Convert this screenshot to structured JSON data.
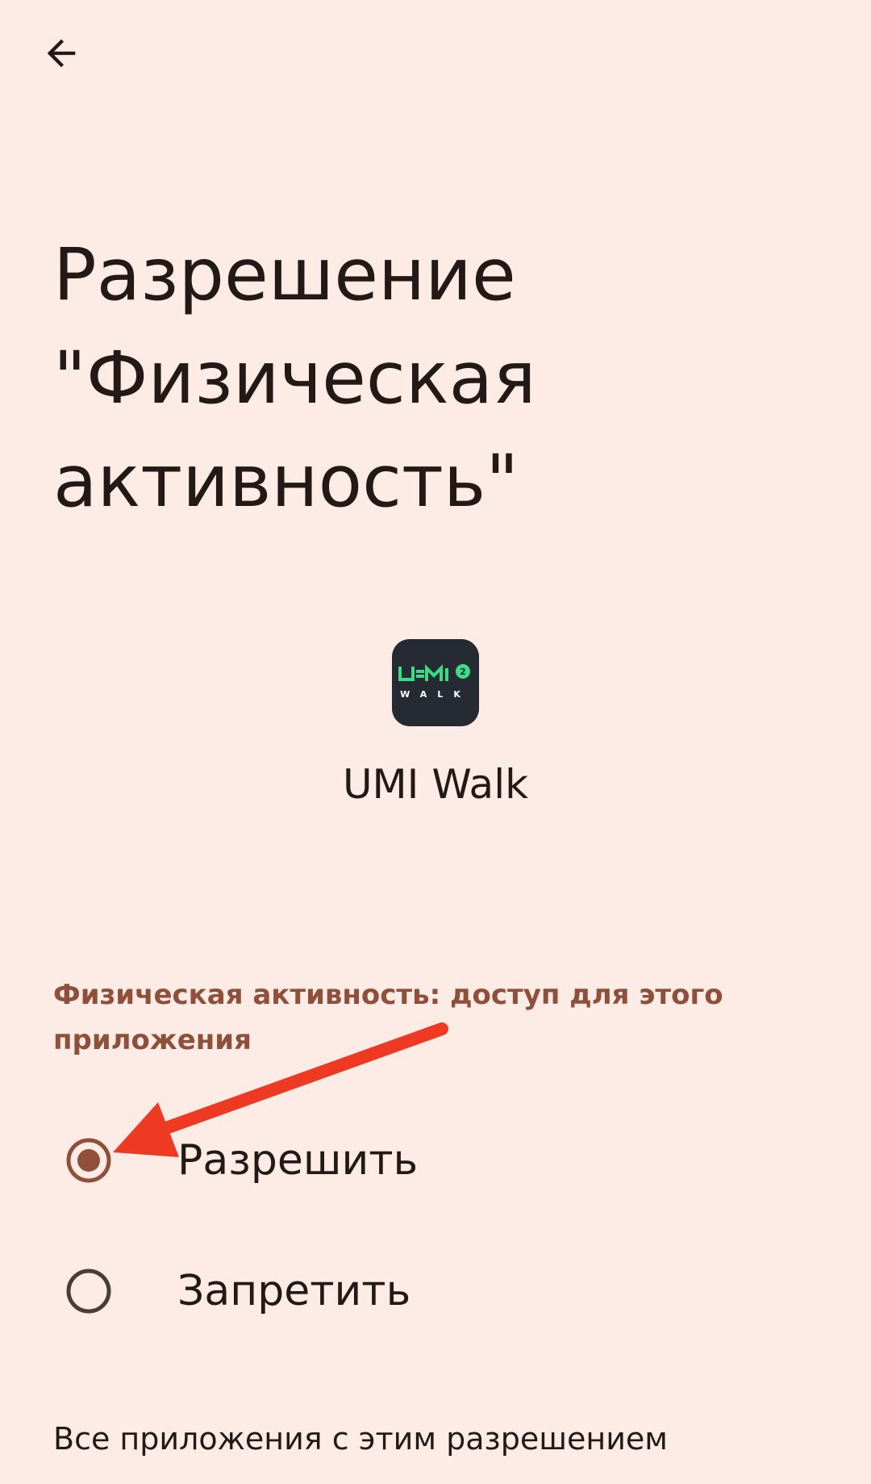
{
  "header": {
    "back_icon": "arrow-back-icon",
    "title": "Разрешение \"Физическая активность\""
  },
  "app": {
    "icon": "umi-walk-app-icon",
    "name": "UMI Walk",
    "icon_bg_color": "#262a33",
    "icon_accent_color": "#3ddc84"
  },
  "permission": {
    "section_title": "Физическая активность: доступ для этого приложения",
    "options": [
      {
        "label": "Разрешить",
        "selected": true
      },
      {
        "label": "Запретить",
        "selected": false
      }
    ]
  },
  "footer": {
    "link": "Все приложения с этим разрешением"
  },
  "colors": {
    "background": "#fdece6",
    "accent": "#8e4f3b",
    "annotation_arrow": "#ee3a22"
  }
}
